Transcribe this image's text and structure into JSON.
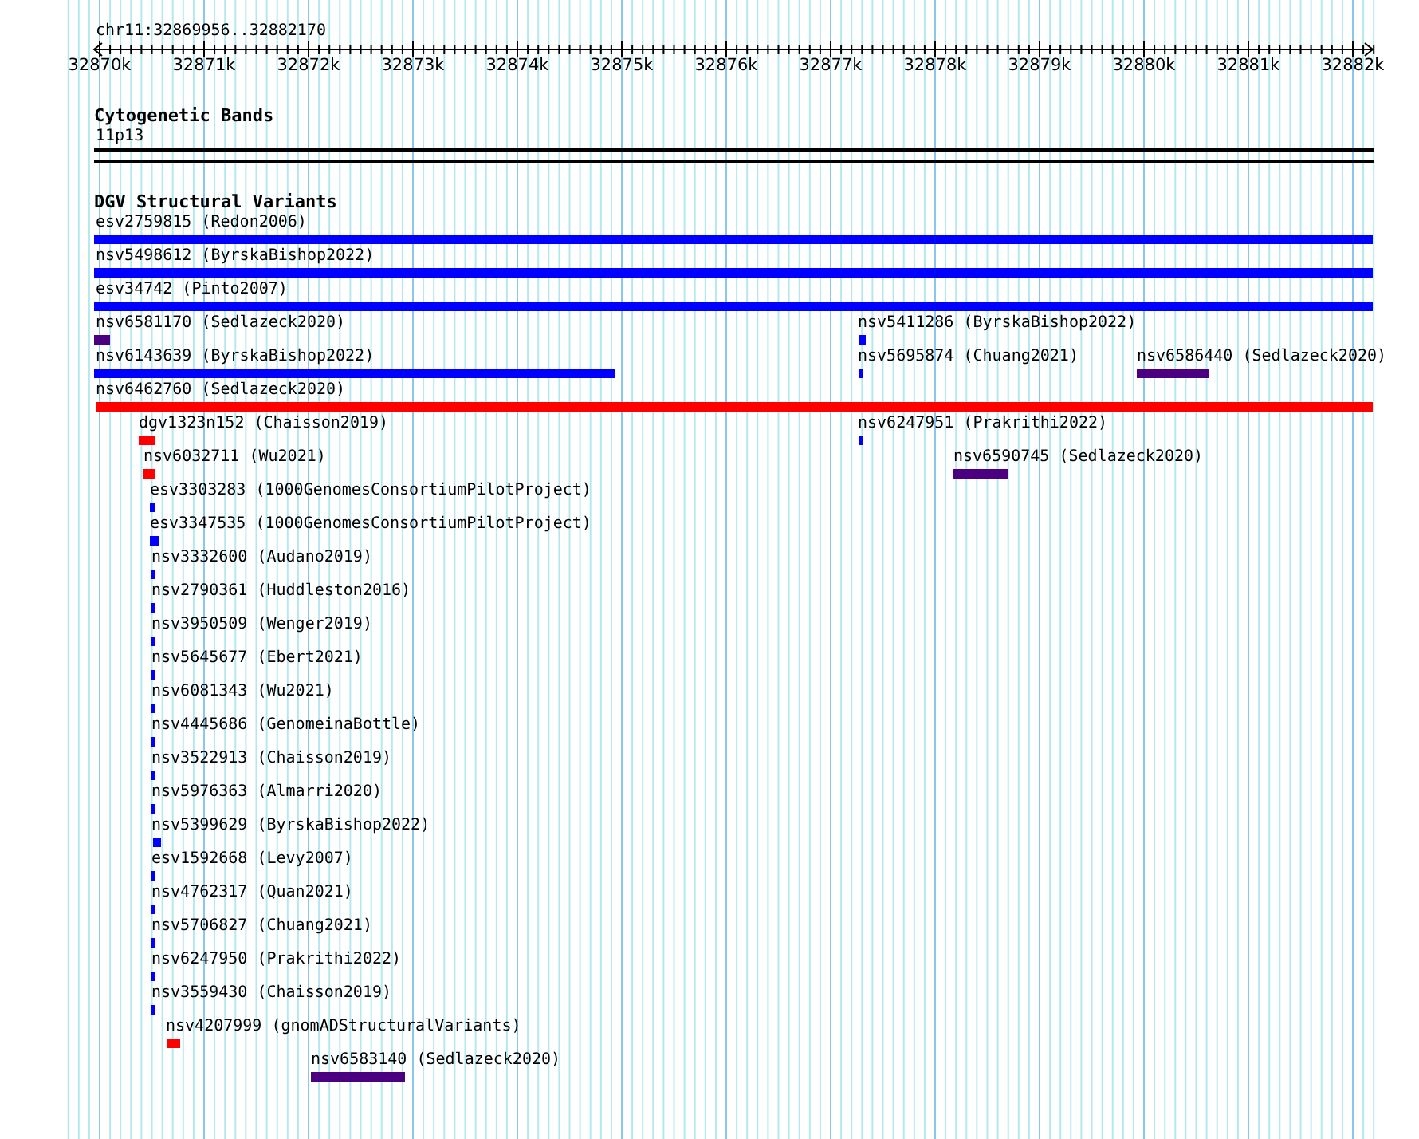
{
  "ruler": {
    "region": "chr11:32869956..32882170",
    "ticks": [
      "32870k",
      "32871k",
      "32872k",
      "32873k",
      "32874k",
      "32875k",
      "32876k",
      "32877k",
      "32878k",
      "32879k",
      "32880k",
      "32881k",
      "32882k"
    ]
  },
  "tracks": [
    {
      "title": "Cytogenetic Bands",
      "kind": "bands",
      "items": [
        {
          "label": "11p13"
        }
      ]
    },
    {
      "title": "DGV Structural Variants",
      "kind": "variants",
      "items": [
        {
          "label": "esv2759815 (Redon2006)",
          "color": "#0000ff"
        },
        {
          "label": "nsv5498612 (ByrskaBishop2022)",
          "color": "#0000ff"
        },
        {
          "label": "esv34742 (Pinto2007)",
          "color": "#0000ff"
        },
        {
          "label": "nsv6581170 (Sedlazeck2020)",
          "color": "#4b0082"
        },
        {
          "label": "nsv5411286 (ByrskaBishop2022)",
          "color": "#0000ff"
        },
        {
          "label": "nsv6143639 (ByrskaBishop2022)",
          "color": "#0000ff"
        },
        {
          "label": "nsv5695874 (Chuang2021)",
          "color": "#0000ff"
        },
        {
          "label": "nsv6586440 (Sedlazeck2020)",
          "color": "#4b0082"
        },
        {
          "label": "nsv6462760 (Sedlazeck2020)",
          "color": "#ff0000"
        },
        {
          "label": "dgv1323n152 (Chaisson2019)",
          "color": "#ff0000"
        },
        {
          "label": "nsv6247951 (Prakrithi2022)",
          "color": "#0000ff"
        },
        {
          "label": "nsv6032711 (Wu2021)",
          "color": "#ff0000"
        },
        {
          "label": "nsv6590745 (Sedlazeck2020)",
          "color": "#4b0082"
        },
        {
          "label": "esv3303283 (1000GenomesConsortiumPilotProject)",
          "color": "#0000ff"
        },
        {
          "label": "esv3347535 (1000GenomesConsortiumPilotProject)",
          "color": "#0000ff"
        },
        {
          "label": "nsv3332600 (Audano2019)",
          "color": "#0000ff"
        },
        {
          "label": "nsv2790361 (Huddleston2016)",
          "color": "#0000ff"
        },
        {
          "label": "nsv3950509 (Wenger2019)",
          "color": "#0000ff"
        },
        {
          "label": "nsv5645677 (Ebert2021)",
          "color": "#0000ff"
        },
        {
          "label": "nsv6081343 (Wu2021)",
          "color": "#0000ff"
        },
        {
          "label": "nsv4445686 (GenomeinaBottle)",
          "color": "#0000ff"
        },
        {
          "label": "nsv3522913 (Chaisson2019)",
          "color": "#0000ff"
        },
        {
          "label": "nsv5976363 (Almarri2020)",
          "color": "#0000ff"
        },
        {
          "label": "nsv5399629 (ByrskaBishop2022)",
          "color": "#0000ff"
        },
        {
          "label": "esv1592668 (Levy2007)",
          "color": "#0000ff"
        },
        {
          "label": "nsv4762317 (Quan2021)",
          "color": "#0000ff"
        },
        {
          "label": "nsv5706827 (Chuang2021)",
          "color": "#0000ff"
        },
        {
          "label": "nsv6247950 (Prakrithi2022)",
          "color": "#0000ff"
        },
        {
          "label": "nsv3559430 (Chaisson2019)",
          "color": "#0000ff"
        },
        {
          "label": "nsv4207999 (gnomADStructuralVariants)",
          "color": "#ff0000"
        },
        {
          "label": "nsv6583140 (Sedlazeck2020)",
          "color": "#4b0082"
        }
      ]
    }
  ]
}
